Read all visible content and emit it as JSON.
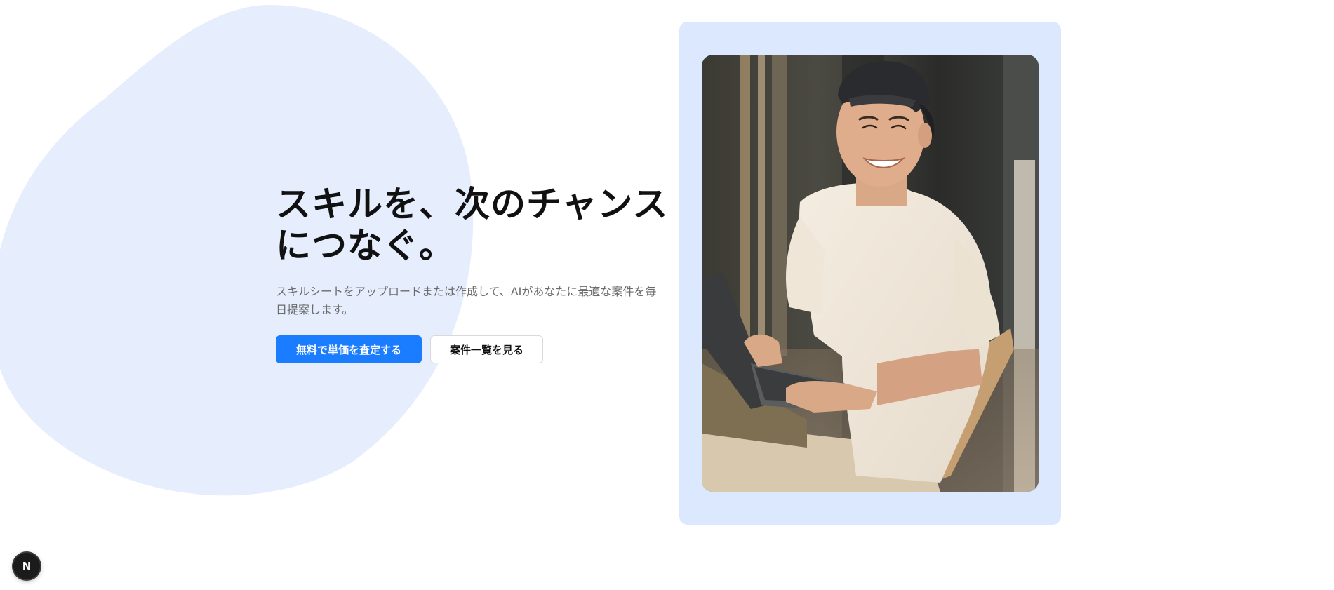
{
  "hero": {
    "title_line1": "スキルを、次のチャンス",
    "title_line2": "につなぐ。",
    "description": "スキルシートをアップロードまたは作成して、AIがあなたに最適な案件を毎日提案します。",
    "primary_button": "無料で単価を査定する",
    "secondary_button": "案件一覧を見る"
  },
  "dev_badge": {
    "letter": "N"
  },
  "colors": {
    "background": "#ffffff",
    "blob": "#e6eefd",
    "primary": "#1a7cff",
    "photo_frame": "#dbe8fd",
    "title": "#111111",
    "description": "#6b6b6b"
  },
  "icons": {
    "dev_badge": "nextjs-logo-icon"
  }
}
